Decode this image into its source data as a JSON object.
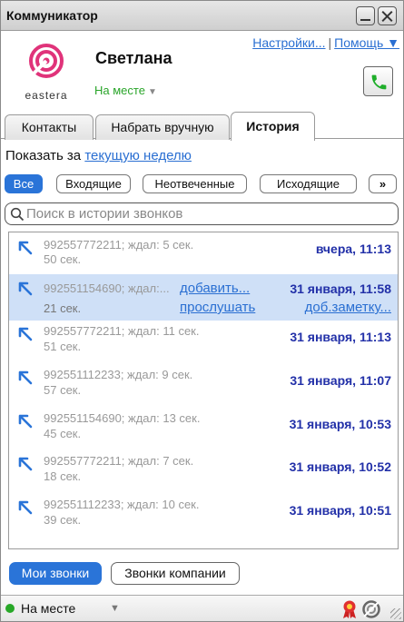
{
  "window": {
    "title": "Коммуникатор"
  },
  "brand": {
    "name": "eastera"
  },
  "user": {
    "name": "Светлана",
    "status": "На месте"
  },
  "links": {
    "settings": "Настройки...",
    "help": "Помощь ▼"
  },
  "tabs": [
    {
      "label": "Контакты"
    },
    {
      "label": "Набрать вручную"
    },
    {
      "label": "История"
    }
  ],
  "period": {
    "prefix": "Показать за",
    "link": "текущую неделю"
  },
  "filters": [
    {
      "label": "Все"
    },
    {
      "label": "Входящие"
    },
    {
      "label": "Неотвеченные"
    },
    {
      "label": "Исходящие"
    },
    {
      "label": "»"
    }
  ],
  "search": {
    "placeholder": "Поиск в истории звонков"
  },
  "calls": [
    {
      "line1": "992557772211; ждал: 5 сек.",
      "line2": "50 сек.",
      "time": "вчера, 11:13"
    },
    {
      "line1": "992551154690; ждал:...",
      "line2": "21 сек.",
      "time": "31 января, 11:58",
      "action_add": "добавить...",
      "action_listen": "прослушать",
      "action_note": "доб.заметку..."
    },
    {
      "line1": "992557772211; ждал: 11 сек.",
      "line2": "51 сек.",
      "time": "31 января, 11:13"
    },
    {
      "line1": "992551112233; ждал: 9 сек.",
      "line2": "57 сек.",
      "time": "31 января, 11:07"
    },
    {
      "line1": "992551154690; ждал: 13 сек.",
      "line2": "45 сек.",
      "time": "31 января, 10:53"
    },
    {
      "line1": "992557772211; ждал: 7 сек.",
      "line2": "18 сек.",
      "time": "31 января, 10:52"
    },
    {
      "line1": "992551112233; ждал: 10 сек.",
      "line2": "39 сек.",
      "time": "31 января, 10:51"
    }
  ],
  "bottom_buttons": {
    "mine": "Мои звонки",
    "company": "Звонки компании"
  },
  "statusbar": {
    "status": "На месте",
    "caret": "▼"
  },
  "colors": {
    "accent": "#2a74d8",
    "link": "#2a6fd2",
    "time": "#2230a8",
    "brand": "#e0337a",
    "online": "#28a828",
    "selected_row": "#cfe0f7"
  },
  "icons": {
    "call": "phone-icon",
    "outgoing": "outgoing-call-arrow-icon",
    "search": "search-icon"
  }
}
